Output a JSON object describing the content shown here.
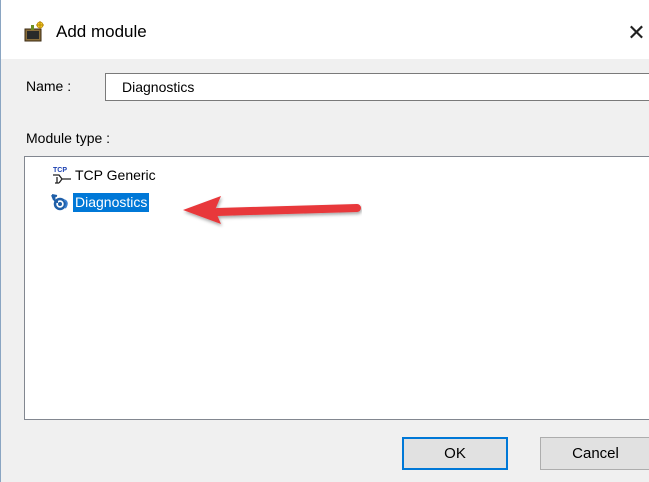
{
  "window": {
    "title": "Add module",
    "close_glyph": "✕",
    "icon": "add-module-icon"
  },
  "name_field": {
    "label": "Name :",
    "value": "Diagnostics"
  },
  "module_type": {
    "label": "Module type :",
    "items": [
      {
        "label": "TCP Generic",
        "icon": "tcp-generic-icon",
        "icon_text": "TCP",
        "selected": false
      },
      {
        "label": "Diagnostics",
        "icon": "diagnostics-icon",
        "selected": true
      }
    ]
  },
  "buttons": {
    "ok": "OK",
    "cancel": "Cancel"
  },
  "annotation": {
    "type": "arrow",
    "color": "#e8373a",
    "points_to": "Diagnostics"
  },
  "colors": {
    "selection": "#0078d7",
    "dialog_bg": "#f0f0f0"
  }
}
